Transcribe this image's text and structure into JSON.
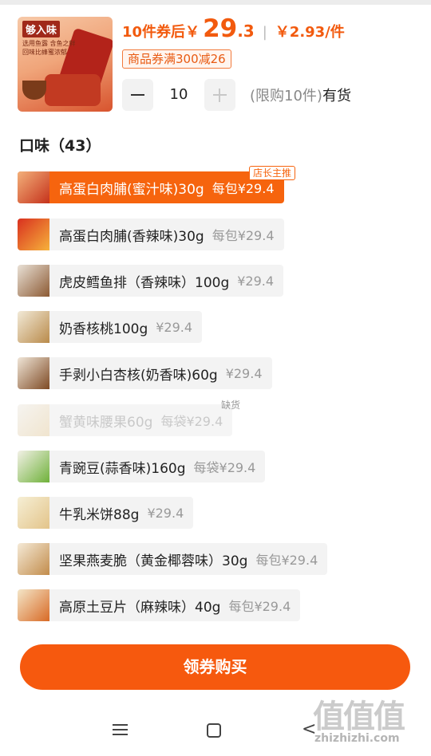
{
  "product": {
    "image_text": "够入味",
    "image_subtext": "选用鱼露 含鱼之鲜 回味比蜂蜜浓郁",
    "price_prefix": "10件券后￥",
    "price_integer": "29",
    "price_decimal": ".3",
    "price_separator": "|",
    "unit_price": "￥2.93/件",
    "coupon": "商品券满300减26"
  },
  "quantity": {
    "value": "10",
    "limit": "(限购10件)",
    "stock": "有货"
  },
  "flavors": {
    "title": "口味（43）",
    "recommend_tag": "店长主推",
    "soldout_tag": "缺货",
    "items": [
      {
        "name": "高蛋白肉脯(蜜汁味)30g",
        "price": "每包¥29.4"
      },
      {
        "name": "高蛋白肉脯(香辣味)30g",
        "price": "每包¥29.4"
      },
      {
        "name": "虎皮鳕鱼排（香辣味）100g",
        "price": "¥29.4"
      },
      {
        "name": "奶香核桃100g",
        "price": "¥29.4"
      },
      {
        "name": "手剥小白杏核(奶香味)60g",
        "price": "¥29.4"
      },
      {
        "name": "蟹黄味腰果60g",
        "price": "每袋¥29.4"
      },
      {
        "name": "青豌豆(蒜香味)160g",
        "price": "每袋¥29.4"
      },
      {
        "name": "牛乳米饼88g",
        "price": "¥29.4"
      },
      {
        "name": "坚果燕麦脆（黄金椰蓉味）30g",
        "price": "每包¥29.4"
      },
      {
        "name": "高原土豆片（麻辣味）40g",
        "price": "每包¥29.4"
      }
    ]
  },
  "buy_button": "领券购买",
  "nav": {
    "back_symbol": "<"
  },
  "watermark": {
    "glyphs": "值值值",
    "url": "zhizhizhi.com"
  },
  "colors": {
    "accent": "#f6590e",
    "selected_bg": "#f6640e",
    "chip_bg": "#f3f3f3"
  }
}
